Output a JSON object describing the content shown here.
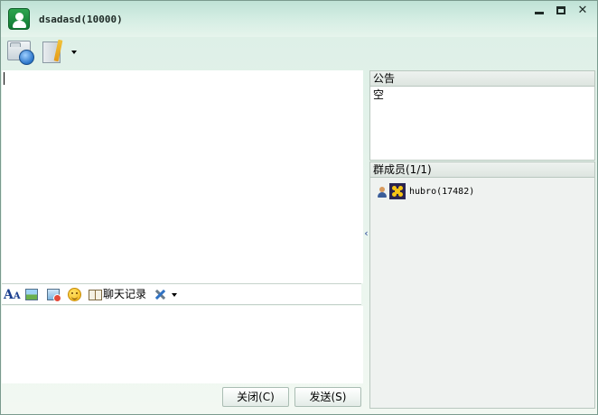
{
  "window": {
    "title": "dsadasd(10000)",
    "controls": {
      "minimize": "minimize",
      "maximize": "maximize",
      "close": "✕"
    }
  },
  "toolbar": {
    "items": [
      {
        "icon": "folder-globe-icon"
      },
      {
        "icon": "notepad-pencil-icon",
        "has_dropdown": true
      }
    ]
  },
  "format_bar": {
    "history_label": "聊天记录"
  },
  "buttons": {
    "close_label": "关闭(C)",
    "send_label": "发送(S)"
  },
  "announcement": {
    "header": "公告",
    "content": "空"
  },
  "members": {
    "header": "群成员(1/1)",
    "list": [
      {
        "name": "hubro(17482)",
        "avatar": "sunflower-avatar",
        "role_icon": "user-icon"
      }
    ]
  },
  "colors": {
    "title_gradient_top": "#bfe2d6",
    "panel_border": "#b9c7bf",
    "accent_blue": "#2b4a9a"
  }
}
